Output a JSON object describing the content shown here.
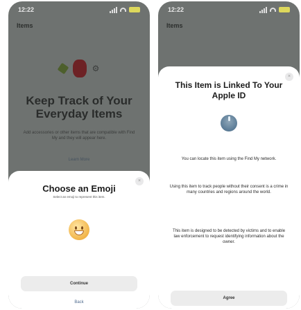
{
  "left_screen": {
    "status_time": "12:22",
    "screen_title": "Items",
    "background": {
      "heading": "Keep Track of Your Everyday Items",
      "body": "Add accessories or other items that are compatible with Find My and they will appear here.",
      "link": "Learn More"
    },
    "sheet": {
      "title": "Choose an Emoji",
      "subtitle": "Select an emoji to represent this item.",
      "close": "×",
      "primary_button": "Continue",
      "back_link": "Back"
    }
  },
  "right_screen": {
    "status_time": "12:22",
    "screen_title": "Items",
    "sheet": {
      "title": "This Item is Linked To Your Apple ID",
      "close": "×",
      "paragraphs": [
        "You can locate this item using the Find My network.",
        "Using this item to track people without their consent is a crime in many countries and regions around the world.",
        "This item is designed to be detected by victims and to enable law enforcement to request identifying information about the owner."
      ],
      "primary_button": "Agree"
    }
  },
  "colors": {
    "dimmed_background": "#6e7270",
    "sheet_background": "#ffffff",
    "button_background": "#ececec",
    "link_color": "#4f6b8e",
    "battery_color": "#ddd85c"
  }
}
